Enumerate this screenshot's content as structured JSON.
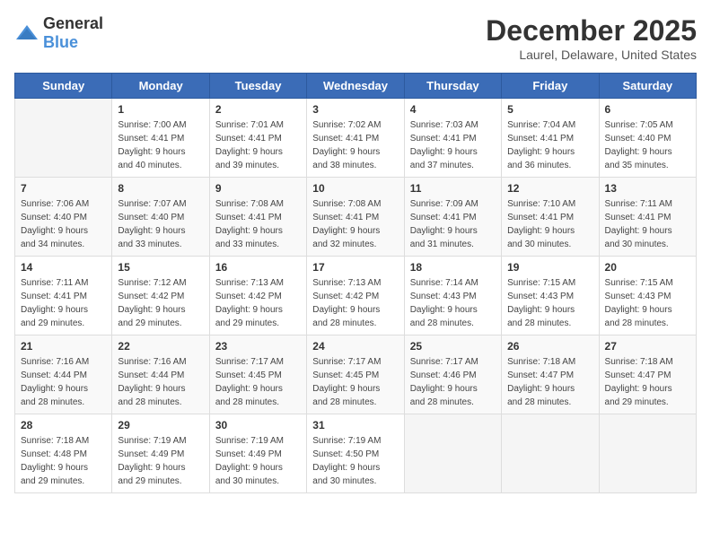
{
  "logo": {
    "general": "General",
    "blue": "Blue"
  },
  "header": {
    "month": "December 2025",
    "location": "Laurel, Delaware, United States"
  },
  "weekdays": [
    "Sunday",
    "Monday",
    "Tuesday",
    "Wednesday",
    "Thursday",
    "Friday",
    "Saturday"
  ],
  "weeks": [
    [
      {
        "day": "",
        "sunrise": "",
        "sunset": "",
        "daylight": ""
      },
      {
        "day": "1",
        "sunrise": "Sunrise: 7:00 AM",
        "sunset": "Sunset: 4:41 PM",
        "daylight": "Daylight: 9 hours and 40 minutes."
      },
      {
        "day": "2",
        "sunrise": "Sunrise: 7:01 AM",
        "sunset": "Sunset: 4:41 PM",
        "daylight": "Daylight: 9 hours and 39 minutes."
      },
      {
        "day": "3",
        "sunrise": "Sunrise: 7:02 AM",
        "sunset": "Sunset: 4:41 PM",
        "daylight": "Daylight: 9 hours and 38 minutes."
      },
      {
        "day": "4",
        "sunrise": "Sunrise: 7:03 AM",
        "sunset": "Sunset: 4:41 PM",
        "daylight": "Daylight: 9 hours and 37 minutes."
      },
      {
        "day": "5",
        "sunrise": "Sunrise: 7:04 AM",
        "sunset": "Sunset: 4:41 PM",
        "daylight": "Daylight: 9 hours and 36 minutes."
      },
      {
        "day": "6",
        "sunrise": "Sunrise: 7:05 AM",
        "sunset": "Sunset: 4:40 PM",
        "daylight": "Daylight: 9 hours and 35 minutes."
      }
    ],
    [
      {
        "day": "7",
        "sunrise": "Sunrise: 7:06 AM",
        "sunset": "Sunset: 4:40 PM",
        "daylight": "Daylight: 9 hours and 34 minutes."
      },
      {
        "day": "8",
        "sunrise": "Sunrise: 7:07 AM",
        "sunset": "Sunset: 4:40 PM",
        "daylight": "Daylight: 9 hours and 33 minutes."
      },
      {
        "day": "9",
        "sunrise": "Sunrise: 7:08 AM",
        "sunset": "Sunset: 4:41 PM",
        "daylight": "Daylight: 9 hours and 33 minutes."
      },
      {
        "day": "10",
        "sunrise": "Sunrise: 7:08 AM",
        "sunset": "Sunset: 4:41 PM",
        "daylight": "Daylight: 9 hours and 32 minutes."
      },
      {
        "day": "11",
        "sunrise": "Sunrise: 7:09 AM",
        "sunset": "Sunset: 4:41 PM",
        "daylight": "Daylight: 9 hours and 31 minutes."
      },
      {
        "day": "12",
        "sunrise": "Sunrise: 7:10 AM",
        "sunset": "Sunset: 4:41 PM",
        "daylight": "Daylight: 9 hours and 30 minutes."
      },
      {
        "day": "13",
        "sunrise": "Sunrise: 7:11 AM",
        "sunset": "Sunset: 4:41 PM",
        "daylight": "Daylight: 9 hours and 30 minutes."
      }
    ],
    [
      {
        "day": "14",
        "sunrise": "Sunrise: 7:11 AM",
        "sunset": "Sunset: 4:41 PM",
        "daylight": "Daylight: 9 hours and 29 minutes."
      },
      {
        "day": "15",
        "sunrise": "Sunrise: 7:12 AM",
        "sunset": "Sunset: 4:42 PM",
        "daylight": "Daylight: 9 hours and 29 minutes."
      },
      {
        "day": "16",
        "sunrise": "Sunrise: 7:13 AM",
        "sunset": "Sunset: 4:42 PM",
        "daylight": "Daylight: 9 hours and 29 minutes."
      },
      {
        "day": "17",
        "sunrise": "Sunrise: 7:13 AM",
        "sunset": "Sunset: 4:42 PM",
        "daylight": "Daylight: 9 hours and 28 minutes."
      },
      {
        "day": "18",
        "sunrise": "Sunrise: 7:14 AM",
        "sunset": "Sunset: 4:43 PM",
        "daylight": "Daylight: 9 hours and 28 minutes."
      },
      {
        "day": "19",
        "sunrise": "Sunrise: 7:15 AM",
        "sunset": "Sunset: 4:43 PM",
        "daylight": "Daylight: 9 hours and 28 minutes."
      },
      {
        "day": "20",
        "sunrise": "Sunrise: 7:15 AM",
        "sunset": "Sunset: 4:43 PM",
        "daylight": "Daylight: 9 hours and 28 minutes."
      }
    ],
    [
      {
        "day": "21",
        "sunrise": "Sunrise: 7:16 AM",
        "sunset": "Sunset: 4:44 PM",
        "daylight": "Daylight: 9 hours and 28 minutes."
      },
      {
        "day": "22",
        "sunrise": "Sunrise: 7:16 AM",
        "sunset": "Sunset: 4:44 PM",
        "daylight": "Daylight: 9 hours and 28 minutes."
      },
      {
        "day": "23",
        "sunrise": "Sunrise: 7:17 AM",
        "sunset": "Sunset: 4:45 PM",
        "daylight": "Daylight: 9 hours and 28 minutes."
      },
      {
        "day": "24",
        "sunrise": "Sunrise: 7:17 AM",
        "sunset": "Sunset: 4:45 PM",
        "daylight": "Daylight: 9 hours and 28 minutes."
      },
      {
        "day": "25",
        "sunrise": "Sunrise: 7:17 AM",
        "sunset": "Sunset: 4:46 PM",
        "daylight": "Daylight: 9 hours and 28 minutes."
      },
      {
        "day": "26",
        "sunrise": "Sunrise: 7:18 AM",
        "sunset": "Sunset: 4:47 PM",
        "daylight": "Daylight: 9 hours and 28 minutes."
      },
      {
        "day": "27",
        "sunrise": "Sunrise: 7:18 AM",
        "sunset": "Sunset: 4:47 PM",
        "daylight": "Daylight: 9 hours and 29 minutes."
      }
    ],
    [
      {
        "day": "28",
        "sunrise": "Sunrise: 7:18 AM",
        "sunset": "Sunset: 4:48 PM",
        "daylight": "Daylight: 9 hours and 29 minutes."
      },
      {
        "day": "29",
        "sunrise": "Sunrise: 7:19 AM",
        "sunset": "Sunset: 4:49 PM",
        "daylight": "Daylight: 9 hours and 29 minutes."
      },
      {
        "day": "30",
        "sunrise": "Sunrise: 7:19 AM",
        "sunset": "Sunset: 4:49 PM",
        "daylight": "Daylight: 9 hours and 30 minutes."
      },
      {
        "day": "31",
        "sunrise": "Sunrise: 7:19 AM",
        "sunset": "Sunset: 4:50 PM",
        "daylight": "Daylight: 9 hours and 30 minutes."
      },
      {
        "day": "",
        "sunrise": "",
        "sunset": "",
        "daylight": ""
      },
      {
        "day": "",
        "sunrise": "",
        "sunset": "",
        "daylight": ""
      },
      {
        "day": "",
        "sunrise": "",
        "sunset": "",
        "daylight": ""
      }
    ]
  ]
}
